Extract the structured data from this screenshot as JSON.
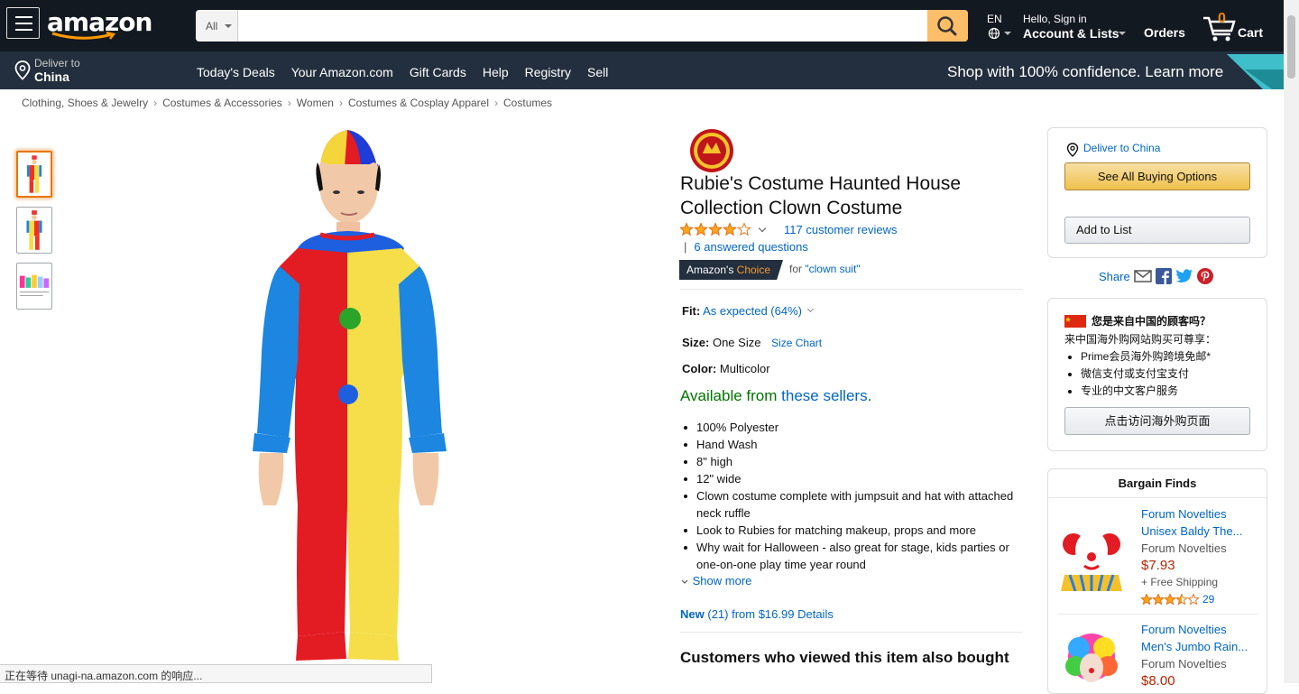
{
  "header": {
    "logo_text": "amazon",
    "search": {
      "category": "All",
      "placeholder": "",
      "value": ""
    },
    "language": "EN",
    "account": {
      "greeting": "Hello, Sign in",
      "label": "Account & Lists"
    },
    "orders": "Orders",
    "cart": {
      "count": "0",
      "label": "Cart"
    }
  },
  "subnav": {
    "deliver_line1": "Deliver to",
    "deliver_line2": "China",
    "links": [
      "Today's Deals",
      "Your Amazon.com",
      "Gift Cards",
      "Help",
      "Registry",
      "Sell"
    ],
    "promo": "Shop with 100% confidence. Learn more"
  },
  "breadcrumb": [
    "Clothing, Shoes & Jewelry",
    "Costumes & Accessories",
    "Women",
    "Costumes & Cosplay Apparel",
    "Costumes"
  ],
  "breadcrumb_separator": "›",
  "product": {
    "title": "Rubie's Costume Haunted House Collection Clown Costume",
    "rating_stars": 4,
    "reviews": "117 customer reviews",
    "answered_sep": "|",
    "answered": "6 answered questions",
    "choice_prefix": "Amazon's",
    "choice_suffix": "Choice",
    "choice_for": "for",
    "choice_query": "\"clown suit\"",
    "fit_label": "Fit:",
    "fit_value": "As expected (64%)",
    "size_label": "Size:",
    "size_value": "One Size",
    "size_chart": "Size Chart",
    "color_label": "Color:",
    "color_value": "Multicolor",
    "avail_prefix": "Available from",
    "avail_link": "these sellers",
    "avail_suffix": ".",
    "bullets": [
      "100% Polyester",
      "Hand Wash",
      "8\" high",
      "12\" wide",
      "Clown costume complete with jumpsuit and hat with attached neck ruffle",
      "Look to Rubies for matching makeup, props and more",
      "Why wait for Halloween - also great for stage, kids parties or one-on-one play time year round"
    ],
    "show_more": "Show more",
    "new_label": "New",
    "new_count": "(21) from $16.99",
    "details": "Details",
    "also_bought": "Customers who viewed this item also bought"
  },
  "buybox": {
    "deliver_to": "Deliver to China",
    "see_all": "See All Buying Options",
    "add_to_list": "Add to List"
  },
  "share_label": "Share",
  "china_box": {
    "title": "您是来自中国的顾客吗？",
    "subtitle": "来中国海外购网站购买可尊享：",
    "items": [
      "Prime会员海外购跨境免邮*",
      "微信支付或支付宝支付",
      "专业的中文客户服务"
    ],
    "button": "点击访问海外购页面"
  },
  "bargain": {
    "title": "Bargain Finds",
    "items": [
      {
        "name": "Forum Novelties Unisex Baldy The...",
        "brand": "Forum Novelties",
        "price": "$7.93",
        "shipping": "+ Free Shipping",
        "stars": 3.5,
        "reviews": "29"
      },
      {
        "name": "Forum Novelties Men's Jumbo Rain...",
        "brand": "Forum Novelties",
        "price": "$8.00"
      }
    ]
  },
  "status_text": "正在等待 unagi-na.amazon.com 的响应...",
  "colors": {
    "nav_dark": "#131921",
    "nav_light": "#232f3e",
    "link": "#0066c0",
    "price": "#b12704",
    "star": "#ffa41c",
    "avail": "#007600"
  }
}
